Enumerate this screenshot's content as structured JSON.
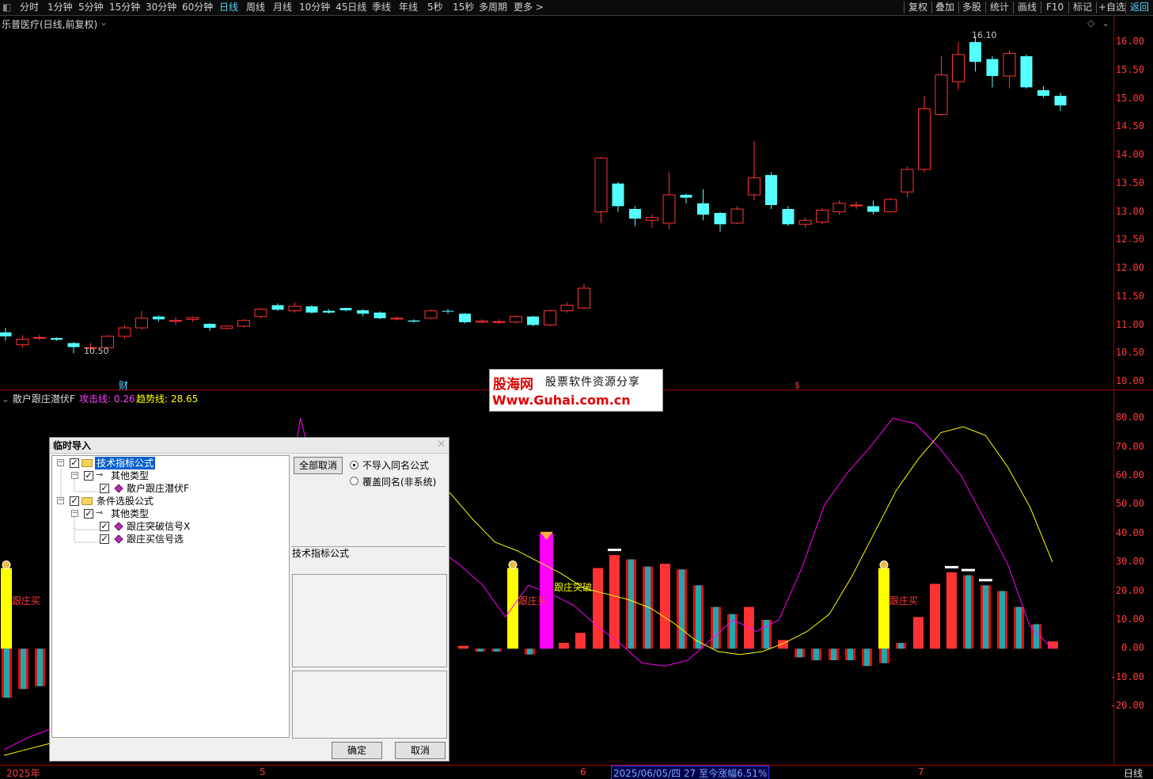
{
  "toolbar": {
    "periods": [
      "分时",
      "1分钟",
      "5分钟",
      "15分钟",
      "30分钟",
      "60分钟",
      "日线",
      "周线",
      "月线",
      "10分钟",
      "45日线",
      "季线",
      "年线",
      "5秒",
      "15秒",
      "多周期",
      "更多 >"
    ],
    "active_period": "日线",
    "right_buttons": [
      "复权",
      "叠加",
      "多股",
      "统计",
      "画线",
      "F10",
      "标记",
      "+自选",
      "返回"
    ]
  },
  "main_pane": {
    "title": "乐普医疗(日线,前复权)",
    "high_label": "16.10",
    "low_label": "10.50",
    "marker_cai": "财",
    "marker_s": "$",
    "price_ticks": [
      "16.00",
      "15.50",
      "15.00",
      "14.50",
      "14.00",
      "13.50",
      "13.00",
      "12.50",
      "12.00",
      "11.50",
      "11.00",
      "10.50",
      "10.00"
    ]
  },
  "indicator_pane": {
    "name": "散户跟庄潜伏F",
    "attack_label": "攻击线:",
    "attack_value": "0.26",
    "trend_label": "趋势线:",
    "trend_value": "28.65",
    "signal_buy": "跟庄买",
    "signal_break": "跟庄突破",
    "ticks": [
      "80.00",
      "70.00",
      "60.00",
      "50.00",
      "40.00",
      "30.00",
      "20.00",
      "10.00",
      "0.00",
      "-10.00",
      "-20.00"
    ]
  },
  "status_bar": {
    "year": "2025年",
    "m5": "5",
    "m6": "6",
    "m7": "7",
    "info": "2025/06/05/四 27 至今涨幅6.51%",
    "period": "日线"
  },
  "watermark": {
    "brand": "股海网",
    "slogan": "股票软件资源分享",
    "url": "Www.Guhai.com.cn"
  },
  "dialog": {
    "title": "临时导入",
    "tree": [
      {
        "label": "技术指标公式"
      },
      {
        "label": "其他类型"
      },
      {
        "label": "散户跟庄潜伏F"
      },
      {
        "label": "条件选股公式"
      },
      {
        "label": "其他类型"
      },
      {
        "label": "跟庄突破信号X"
      },
      {
        "label": "跟庄买信号选"
      }
    ],
    "cancel_all": "全部取消",
    "opt_no_import": "不导入同名公式",
    "opt_overwrite": "覆盖同名(非系统)",
    "section_label": "技术指标公式",
    "ok": "确定",
    "cancel": "取消"
  },
  "colors": {
    "up": "#ff3333",
    "down": "#54ffff",
    "magenta": "#ff00ff",
    "yellow": "#ffff00",
    "axis": "#a00000"
  },
  "chart_data": {
    "type": "candlestick",
    "price_ylim": [
      10.0,
      16.1
    ],
    "candles": [
      [
        10.87,
        10.8,
        10.95,
        10.72
      ],
      [
        10.65,
        10.75,
        10.82,
        10.6
      ],
      [
        10.78,
        10.78,
        10.83,
        10.73
      ],
      [
        10.77,
        10.74,
        10.78,
        10.72
      ],
      [
        10.68,
        10.61,
        10.7,
        10.5
      ],
      [
        10.6,
        10.6,
        10.68,
        10.55
      ],
      [
        10.6,
        10.8,
        10.82,
        10.58
      ],
      [
        10.8,
        10.95,
        11.0,
        10.75
      ],
      [
        10.95,
        11.12,
        11.25,
        10.92
      ],
      [
        11.15,
        11.1,
        11.17,
        11.06
      ],
      [
        11.08,
        11.08,
        11.14,
        11.0
      ],
      [
        11.1,
        11.13,
        11.15,
        11.05
      ],
      [
        11.02,
        10.95,
        11.03,
        10.9
      ],
      [
        10.94,
        10.98,
        11.0,
        10.92
      ],
      [
        10.98,
        11.08,
        11.1,
        10.95
      ],
      [
        11.15,
        11.28,
        11.3,
        11.12
      ],
      [
        11.35,
        11.27,
        11.38,
        11.25
      ],
      [
        11.25,
        11.33,
        11.4,
        11.22
      ],
      [
        11.33,
        11.22,
        11.35,
        11.2
      ],
      [
        11.25,
        11.22,
        11.28,
        11.2
      ],
      [
        11.3,
        11.26,
        11.31,
        11.24
      ],
      [
        11.26,
        11.2,
        11.28,
        11.15
      ],
      [
        11.22,
        11.12,
        11.24,
        11.1
      ],
      [
        11.12,
        11.12,
        11.15,
        11.08
      ],
      [
        11.08,
        11.06,
        11.1,
        11.04
      ],
      [
        11.12,
        11.25,
        11.27,
        11.1
      ],
      [
        11.25,
        11.24,
        11.28,
        11.2
      ],
      [
        11.2,
        11.05,
        11.21,
        11.03
      ],
      [
        11.05,
        11.07,
        11.1,
        11.03
      ],
      [
        11.05,
        11.06,
        11.1,
        11.02
      ],
      [
        11.05,
        11.15,
        11.17,
        11.03
      ],
      [
        11.15,
        11.0,
        11.16,
        10.98
      ],
      [
        11.0,
        11.25,
        11.27,
        10.98
      ],
      [
        11.25,
        11.35,
        11.4,
        11.22
      ],
      [
        11.3,
        11.65,
        11.72,
        11.28
      ],
      [
        13.0,
        13.95,
        13.97,
        12.8
      ],
      [
        13.5,
        13.1,
        13.53,
        13.0
      ],
      [
        13.05,
        12.88,
        13.1,
        12.75
      ],
      [
        12.85,
        12.9,
        12.95,
        12.72
      ],
      [
        12.8,
        13.3,
        13.7,
        12.7
      ],
      [
        13.3,
        13.25,
        13.32,
        13.15
      ],
      [
        13.15,
        12.95,
        13.4,
        12.85
      ],
      [
        12.98,
        12.78,
        13.0,
        12.65
      ],
      [
        12.8,
        13.05,
        13.1,
        12.78
      ],
      [
        13.3,
        13.6,
        14.25,
        13.2
      ],
      [
        13.65,
        13.12,
        13.7,
        13.05
      ],
      [
        13.05,
        12.78,
        13.1,
        12.75
      ],
      [
        12.78,
        12.85,
        12.9,
        12.72
      ],
      [
        12.82,
        13.03,
        13.06,
        12.78
      ],
      [
        13.0,
        13.15,
        13.2,
        12.95
      ],
      [
        13.12,
        13.12,
        13.18,
        13.05
      ],
      [
        13.1,
        13.0,
        13.2,
        12.95
      ],
      [
        13.0,
        13.22,
        13.25,
        12.98
      ],
      [
        13.35,
        13.75,
        13.8,
        13.25
      ],
      [
        13.75,
        14.82,
        15.05,
        13.7
      ],
      [
        14.72,
        15.42,
        15.75,
        14.7
      ],
      [
        15.3,
        15.78,
        16.0,
        15.15
      ],
      [
        16.0,
        15.65,
        16.1,
        15.48
      ],
      [
        15.7,
        15.4,
        15.75,
        15.2
      ],
      [
        15.4,
        15.8,
        15.85,
        15.18
      ],
      [
        15.75,
        15.2,
        15.78,
        15.18
      ],
      [
        15.15,
        15.05,
        15.22,
        15.02
      ],
      [
        15.05,
        14.88,
        15.1,
        14.78
      ]
    ],
    "indicator_ylim": [
      -40,
      85
    ],
    "bars": [
      [
        -17,
        "c"
      ],
      [
        -14,
        "c"
      ],
      [
        -13,
        "c"
      ],
      [
        1,
        "r"
      ],
      [
        -1,
        "c"
      ],
      [
        -1,
        "c"
      ],
      [
        -2,
        "c"
      ],
      [
        2,
        "r"
      ],
      [
        5.5,
        "r"
      ],
      [
        28,
        "r"
      ],
      [
        32.5,
        "r"
      ],
      [
        31,
        "c"
      ],
      [
        28.5,
        "c"
      ],
      [
        29.5,
        "r"
      ],
      [
        27.5,
        "c"
      ],
      [
        22,
        "c"
      ],
      [
        14.5,
        "c"
      ],
      [
        12,
        "c"
      ],
      [
        14.5,
        "r"
      ],
      [
        10,
        "c"
      ],
      [
        3,
        "r"
      ],
      [
        -3,
        "c"
      ],
      [
        -4,
        "c"
      ],
      [
        -4,
        "c"
      ],
      [
        -4,
        "c"
      ],
      [
        -6,
        "c"
      ],
      [
        -5,
        "c"
      ],
      [
        2,
        "c"
      ],
      [
        11,
        "r"
      ],
      [
        22.5,
        "r"
      ],
      [
        26.5,
        "r"
      ],
      [
        25.5,
        "c"
      ],
      [
        22,
        "c"
      ],
      [
        20,
        "c"
      ],
      [
        14.5,
        "c"
      ],
      [
        8.5,
        "c"
      ],
      [
        2.5,
        "r"
      ]
    ],
    "attack_line": [
      -35,
      -31,
      -28,
      -23,
      -20,
      -13,
      -15,
      -18,
      -21,
      -11,
      -22,
      -5,
      30,
      80,
      50,
      40,
      33,
      25,
      32,
      35,
      29,
      22,
      11,
      22,
      19,
      15,
      8,
      2,
      -5,
      -6,
      -4,
      3,
      10,
      6,
      10,
      28,
      50,
      61,
      70,
      80,
      78,
      70,
      60,
      45,
      30,
      8,
      0
    ],
    "trend_line": [
      -37,
      -35,
      -33,
      -30,
      -28,
      -24,
      -20,
      -17,
      -14,
      -17,
      -15,
      -16,
      -17,
      -18,
      -7,
      15,
      32,
      46,
      54,
      57,
      54,
      45,
      37,
      34,
      30,
      26,
      21,
      19,
      17,
      14,
      9,
      3,
      -1,
      -2,
      -1,
      2,
      6,
      12,
      25,
      40,
      55,
      66,
      75,
      77,
      74,
      63,
      49,
      30
    ]
  }
}
